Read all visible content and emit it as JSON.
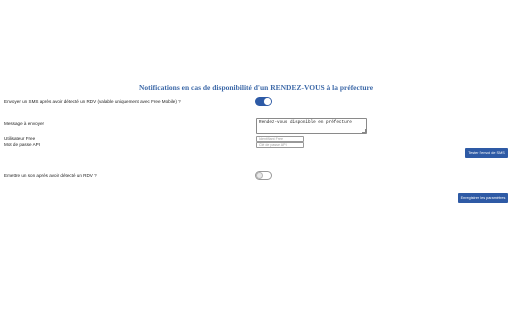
{
  "page": {
    "title": "Notifications en cas de disponibilité d'un RENDEZ-VOUS à la préfecture"
  },
  "sms": {
    "toggle_label": "Envoyer un SMS après avoir détecté un RDV (valable uniquement avec Free Mobile) ?",
    "enabled": true,
    "message_label": "Message à envoyer",
    "message_value": "Rendez-vous disponible en préfecture",
    "user_label": "Utilisateur Free",
    "user_placeholder": "Identifiant Free",
    "password_label": "Mot de passe API",
    "password_placeholder": "Clé de passe API",
    "test_button": "Tester l'envoi de SMS"
  },
  "sound": {
    "toggle_label": "Emettre un son après avoir détecté un RDV ?",
    "enabled": false
  },
  "footer": {
    "save_button": "Enregistrer les paramètres"
  },
  "colors": {
    "accent": "#2e5aa5",
    "title": "#3d69a8"
  }
}
